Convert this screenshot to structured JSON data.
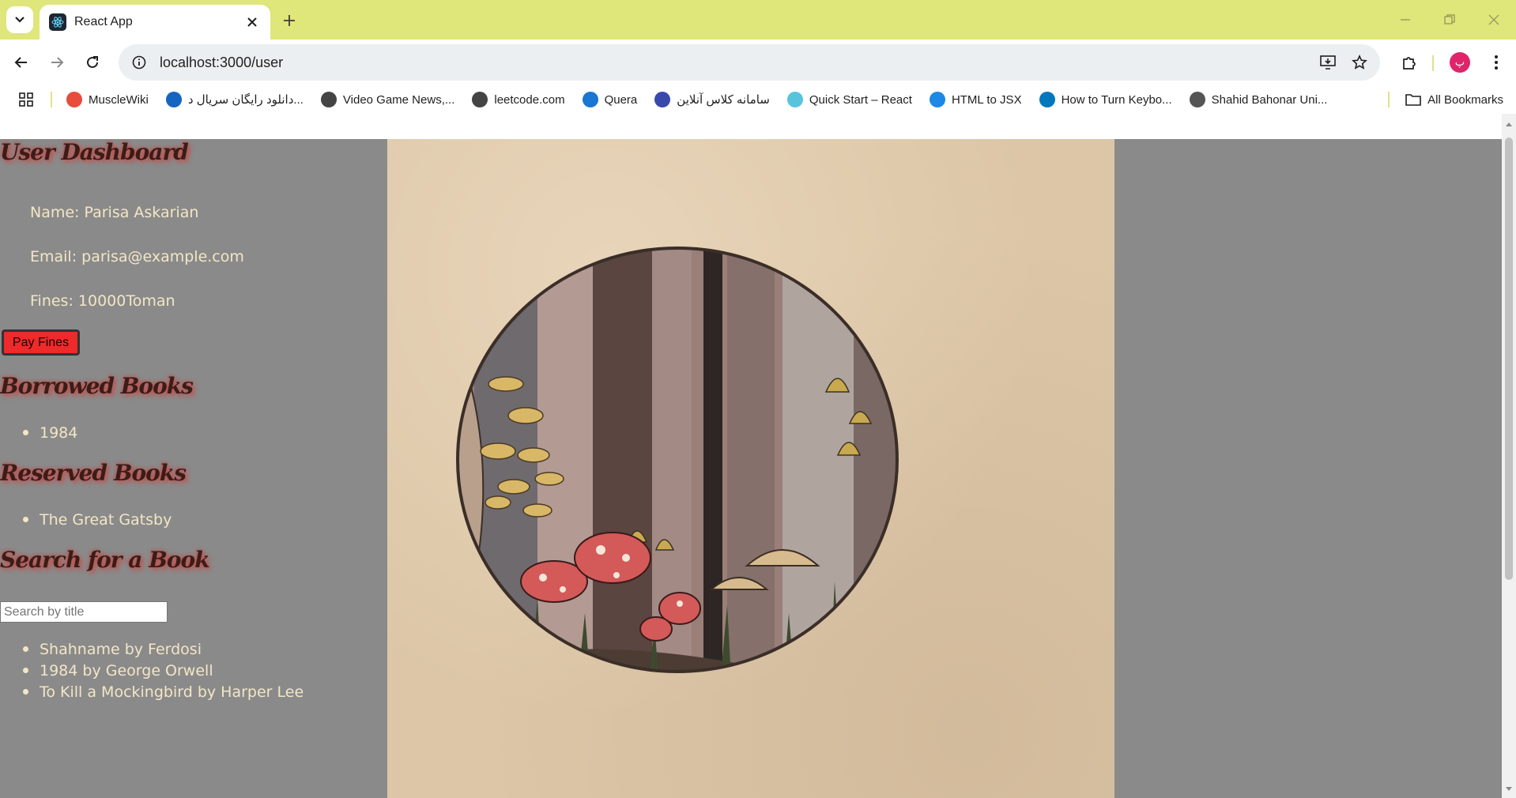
{
  "browser": {
    "tab_title": "React App",
    "url": "localhost:3000/user",
    "profile_initial": "پ",
    "bookmarks": [
      {
        "label": "MuscleWiki",
        "icon": "musclewiki-icon",
        "color": "#e74c3c"
      },
      {
        "label": "دانلود رایگان سریال د...",
        "icon": "r-site-icon",
        "color": "#1565c0"
      },
      {
        "label": "Video Game News,...",
        "icon": "globe-icon",
        "color": "#444444"
      },
      {
        "label": "leetcode.com",
        "icon": "globe-icon",
        "color": "#444444"
      },
      {
        "label": "Quera",
        "icon": "quera-icon",
        "color": "#1976d2"
      },
      {
        "label": "سامانه کلاس آنلاین",
        "icon": "books-icon",
        "color": "#3949ab"
      },
      {
        "label": "Quick Start – React",
        "icon": "react-icon",
        "color": "#58c4dc"
      },
      {
        "label": "HTML to JSX",
        "icon": "transform-icon",
        "color": "#1e88e5"
      },
      {
        "label": "How to Turn Keybo...",
        "icon": "hp-icon",
        "color": "#0277bd"
      },
      {
        "label": "Shahid Bahonar Uni...",
        "icon": "university-icon",
        "color": "#555555"
      }
    ],
    "all_bookmarks": "All Bookmarks"
  },
  "page": {
    "title": "User Dashboard",
    "name_line": "Name: Parisa Askarian",
    "email_line": "Email: parisa@example.com",
    "fines_line": "Fines: 10000Toman",
    "pay_button": "Pay Fines",
    "borrowed_heading": "Borrowed Books",
    "borrowed_books": [
      "1984"
    ],
    "reserved_heading": "Reserved Books",
    "reserved_books": [
      "The Great Gatsby"
    ],
    "search_heading": "Search for a Book",
    "search_placeholder": "Search by title",
    "search_results": [
      "Shahname by Ferdosi",
      "1984 by George Orwell",
      "To Kill a Mockingbird by Harper Lee"
    ]
  },
  "colors": {
    "page_background": "#8a8a8a",
    "heading_shadow": "#c0504d",
    "pay_button": "#ee2a2a",
    "text": "#f3e6c6",
    "tab_strip": "#dfe67a"
  }
}
